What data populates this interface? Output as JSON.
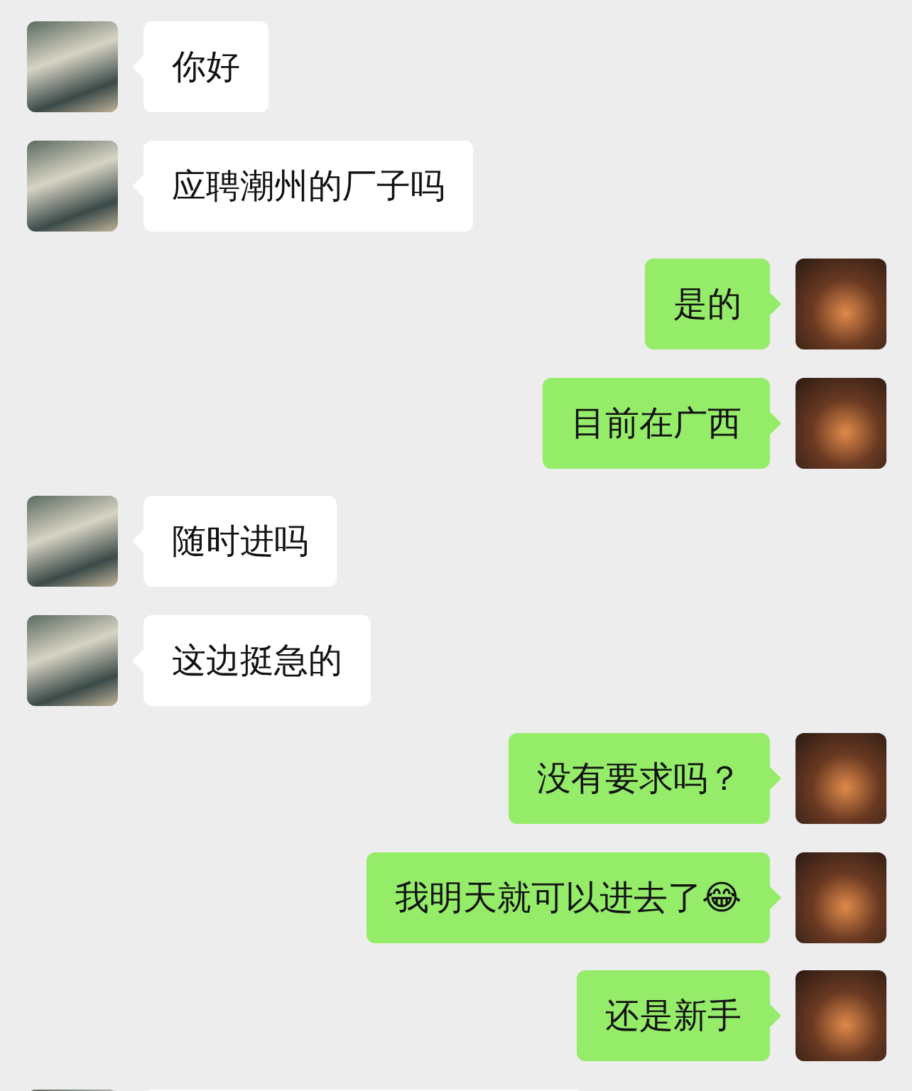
{
  "messages": [
    {
      "kind": "incoming",
      "text": "你好"
    },
    {
      "kind": "incoming",
      "text": "应聘潮州的厂子吗"
    },
    {
      "kind": "outgoing",
      "text": "是的"
    },
    {
      "kind": "outgoing",
      "text": "目前在广西"
    },
    {
      "kind": "incoming",
      "text": "随时进吗"
    },
    {
      "kind": "incoming",
      "text": "这边挺急的"
    },
    {
      "kind": "outgoing",
      "text": "没有要求吗？"
    },
    {
      "kind": "outgoing",
      "text": "我明天就可以进去了😂"
    },
    {
      "kind": "outgoing",
      "text": "还是新手"
    }
  ]
}
